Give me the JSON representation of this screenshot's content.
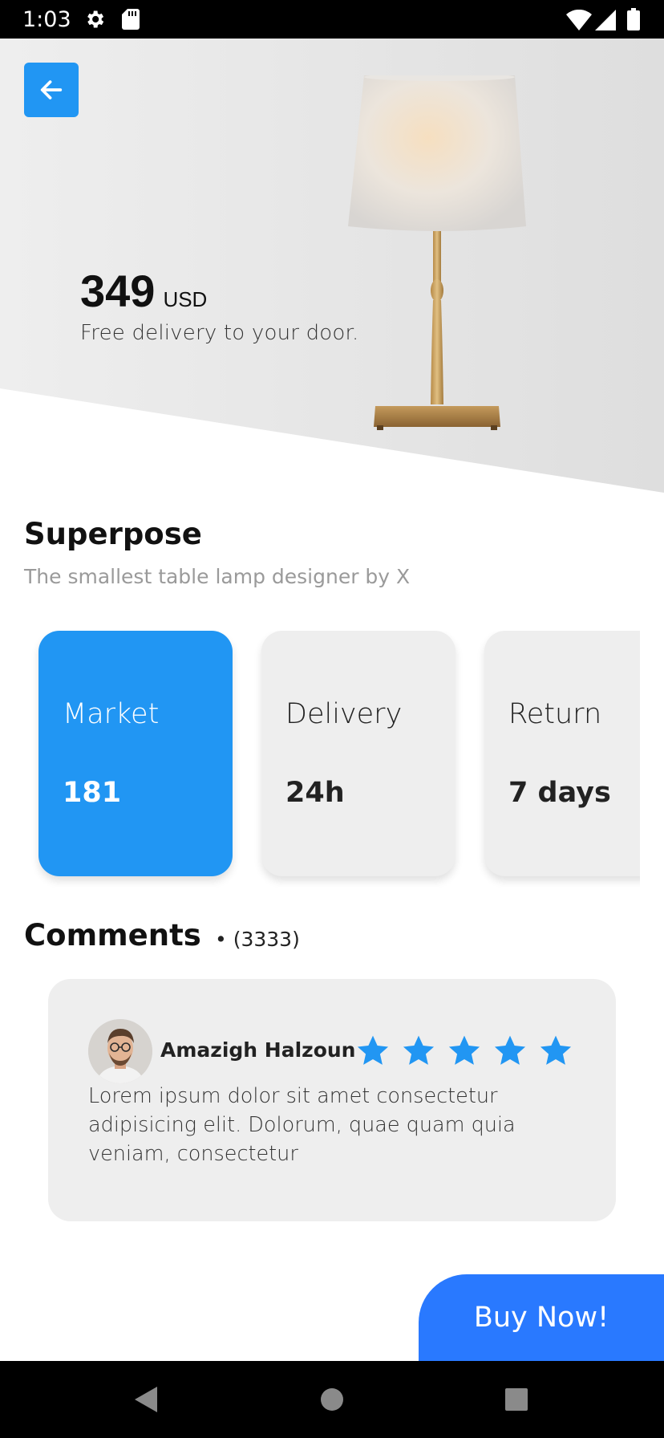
{
  "status_bar": {
    "time": "1:03",
    "icons": [
      "gear-icon",
      "sd-card-icon",
      "wifi-icon",
      "signal-icon",
      "battery-icon"
    ]
  },
  "hero": {
    "back_icon": "arrow-left-icon",
    "price": "349",
    "currency": "USD",
    "delivery_note": "Free delivery to your door."
  },
  "product": {
    "name": "Superpose",
    "subtitle": "The smallest table lamp designer by X"
  },
  "stats": [
    {
      "title": "Market",
      "value": "181",
      "active": true
    },
    {
      "title": "Delivery",
      "value": "24h",
      "active": false
    },
    {
      "title": "Return",
      "value": "7 days",
      "active": false
    }
  ],
  "comments": {
    "heading": "Comments",
    "count": "• (3333)",
    "items": [
      {
        "author": "Amazigh Halzoun",
        "rating": 5,
        "text": "Lorem ipsum dolor sit amet consectetur adipisicing elit. Dolorum, quae quam quia veniam, consectetur"
      }
    ]
  },
  "buy_label": "Buy Now!",
  "nav_bar": {
    "icons": [
      "back-triangle-icon",
      "home-circle-icon",
      "recents-square-icon"
    ]
  },
  "colors": {
    "accent": "#2196f3",
    "buy": "#2979ff",
    "hero_bg": "#e2e2e2",
    "card_bg": "#eeeeee"
  }
}
